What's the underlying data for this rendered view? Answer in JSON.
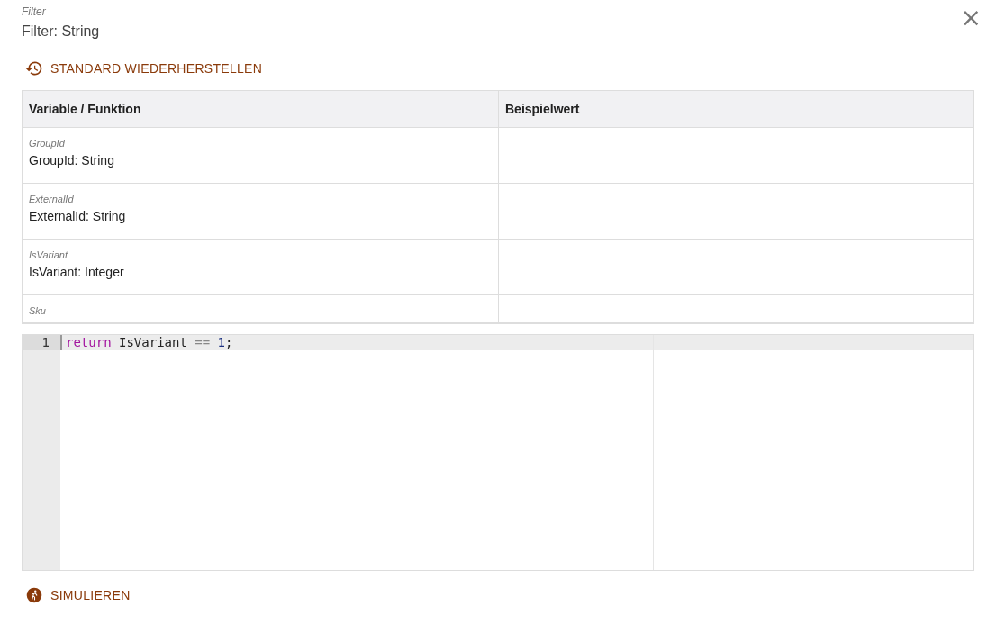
{
  "dialog": {
    "caption": "Filter",
    "title": "Filter: String",
    "close": "×"
  },
  "reset_button": {
    "label": "STANDARD WIEDERHERSTELLEN"
  },
  "table": {
    "columns": [
      "Variable / Funktion",
      "Beispielwert"
    ],
    "rows": [
      {
        "name": "GroupId",
        "signature": "GroupId: String"
      },
      {
        "name": "ExternalId",
        "signature": "ExternalId: String"
      },
      {
        "name": "IsVariant",
        "signature": "IsVariant: Integer"
      },
      {
        "name": "Sku"
      }
    ]
  },
  "editor": {
    "lines": [
      {
        "number": "1",
        "selected": true,
        "tokens": [
          {
            "kind": "keyword",
            "text": "return"
          },
          {
            "kind": "plain",
            "text": " IsVariant "
          },
          {
            "kind": "operator",
            "text": "=="
          },
          {
            "kind": "number",
            "text": " 1"
          },
          {
            "kind": "plain",
            "text": ";"
          }
        ]
      }
    ]
  },
  "simulate_button": {
    "label": "SIMULIEREN"
  }
}
